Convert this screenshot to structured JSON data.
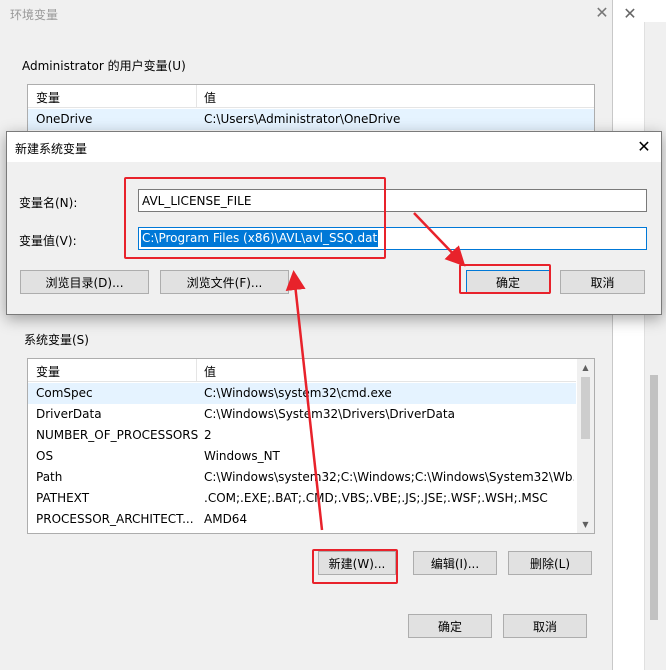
{
  "env_dialog": {
    "title": "环境变量",
    "user_group_label": "Administrator 的用户变量(U)",
    "user_columns": [
      "变量",
      "值"
    ],
    "user_rows": [
      {
        "name": "OneDrive",
        "value": "C:\\Users\\Administrator\\OneDrive"
      }
    ],
    "system_group_label": "系统变量(S)",
    "system_columns": [
      "变量",
      "值"
    ],
    "system_rows": [
      {
        "name": "ComSpec",
        "value": "C:\\Windows\\system32\\cmd.exe"
      },
      {
        "name": "DriverData",
        "value": "C:\\Windows\\System32\\Drivers\\DriverData"
      },
      {
        "name": "NUMBER_OF_PROCESSORS",
        "value": "2"
      },
      {
        "name": "OS",
        "value": "Windows_NT"
      },
      {
        "name": "Path",
        "value": "C:\\Windows\\system32;C:\\Windows;C:\\Windows\\System32\\Wb..."
      },
      {
        "name": "PATHEXT",
        "value": ".COM;.EXE;.BAT;.CMD;.VBS;.VBE;.JS;.JSE;.WSF;.WSH;.MSC"
      },
      {
        "name": "PROCESSOR_ARCHITECT...",
        "value": "AMD64"
      }
    ],
    "new_button": "新建(W)...",
    "edit_button": "编辑(I)...",
    "delete_button": "删除(L)",
    "ok_button": "确定",
    "cancel_button": "取消"
  },
  "new_dialog": {
    "title": "新建系统变量",
    "name_label": "变量名(N):",
    "name_value": "AVL_LICENSE_FILE",
    "value_label": "变量值(V):",
    "value_value": "C:\\Program Files (x86)\\AVL\\avl_SSQ.dat",
    "browse_dir_button": "浏览目录(D)...",
    "browse_file_button": "浏览文件(F)...",
    "ok_button": "确定",
    "cancel_button": "取消"
  },
  "colors": {
    "annotation_red": "#e8222b",
    "selection_blue": "#0078d7"
  },
  "icons": {
    "close": "✕",
    "scroll_up": "▲",
    "scroll_down": "▼"
  }
}
